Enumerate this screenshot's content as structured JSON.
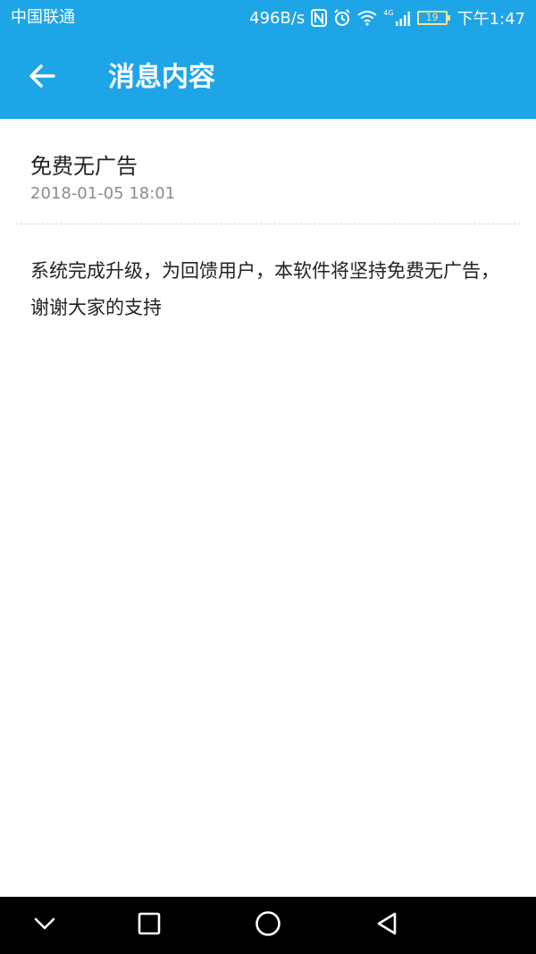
{
  "status_bar": {
    "carrier": "中国联通",
    "network_speed": "496B/s",
    "network_type": "4G",
    "battery_level": "19",
    "time": "下午1:47",
    "icons": [
      "nfc-icon",
      "alarm-icon",
      "wifi-icon",
      "signal-icon",
      "battery-icon"
    ]
  },
  "app_bar": {
    "title": "消息内容",
    "back_icon": "arrow-left-icon"
  },
  "message": {
    "title": "免费无广告",
    "time": "2018-01-05 18:01",
    "body": "系统完成升级，为回馈用户，本软件将坚持免费无广告，谢谢大家的支持"
  },
  "nav_bar": {
    "icons": [
      "chevron-down-icon",
      "square-icon",
      "circle-icon",
      "triangle-back-icon"
    ]
  },
  "colors": {
    "primary": "#1ea5e8",
    "text_primary": "#222222",
    "text_secondary": "#8c8c8c",
    "battery_warning": "#ffe08a"
  }
}
